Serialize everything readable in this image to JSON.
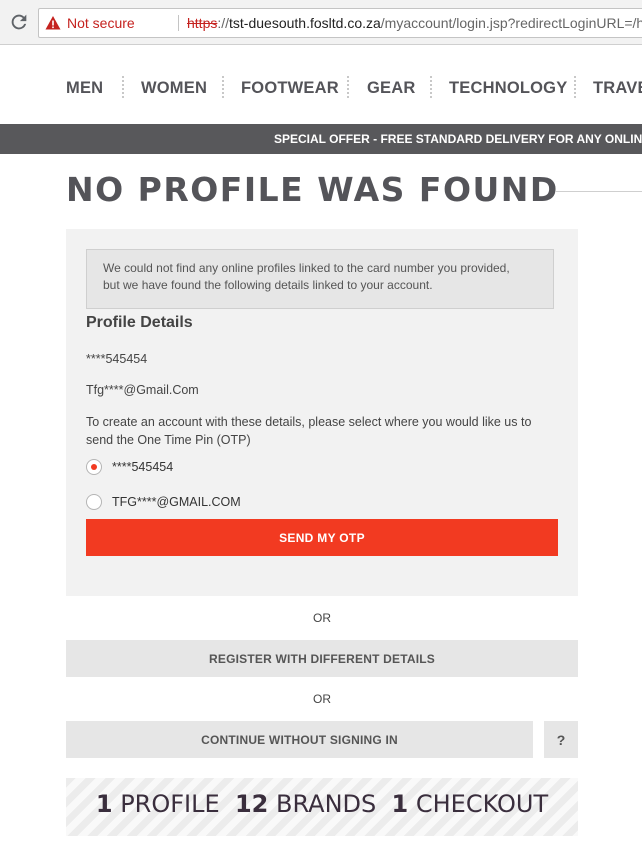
{
  "browser": {
    "security_label": "Not secure",
    "url_protocol": "https",
    "url_separator": "://",
    "url_host": "tst-duesouth.fosltd.co.za",
    "url_path": "/myaccount/login.jsp?redirectLoginURL=/home&"
  },
  "nav": {
    "items": [
      {
        "label": "MEN"
      },
      {
        "label": "WOMEN"
      },
      {
        "label": "FOOTWEAR"
      },
      {
        "label": "GEAR"
      },
      {
        "label": "TECHNOLOGY"
      },
      {
        "label": "TRAVEL"
      }
    ]
  },
  "promo": {
    "text": "SPECIAL OFFER - FREE STANDARD DELIVERY FOR ANY ONLINE ORDER"
  },
  "page": {
    "title": "NO PROFILE WAS FOUND"
  },
  "notice": {
    "line1": "We could not find any online profiles linked to the card number you provided,",
    "line2": "but we have found the following details linked to your account."
  },
  "profile": {
    "section_title": "Profile Details",
    "phone": "****545454",
    "email": "Tfg****@Gmail.Com",
    "instructions": "To create an account with these details, please select where you would like us to send the One Time Pin (OTP)",
    "options": [
      {
        "label": "****545454",
        "selected": true
      },
      {
        "label": "TFG****@GMAIL.COM",
        "selected": false
      }
    ],
    "send_button": "SEND MY OTP"
  },
  "alternatives": {
    "or1": "OR",
    "register_button": "REGISTER WITH DIFFERENT DETAILS",
    "or2": "OR",
    "continue_button": "CONTINUE WITHOUT SIGNING IN",
    "help_button": "?"
  },
  "banner": {
    "part1_num": "1",
    "part1_word": "PROFILE",
    "part2_num": "12",
    "part2_word": "BRANDS",
    "part3_num": "1",
    "part3_word": "CHECKOUT"
  },
  "colors": {
    "accent": "#f23a21",
    "promo_bg": "#58585b",
    "panel_bg": "#f2f2f2",
    "button_grey": "#e6e6e6",
    "heading": "#545459",
    "insecure": "#c5221f"
  },
  "icons": [
    "reload-icon",
    "warning-icon"
  ]
}
